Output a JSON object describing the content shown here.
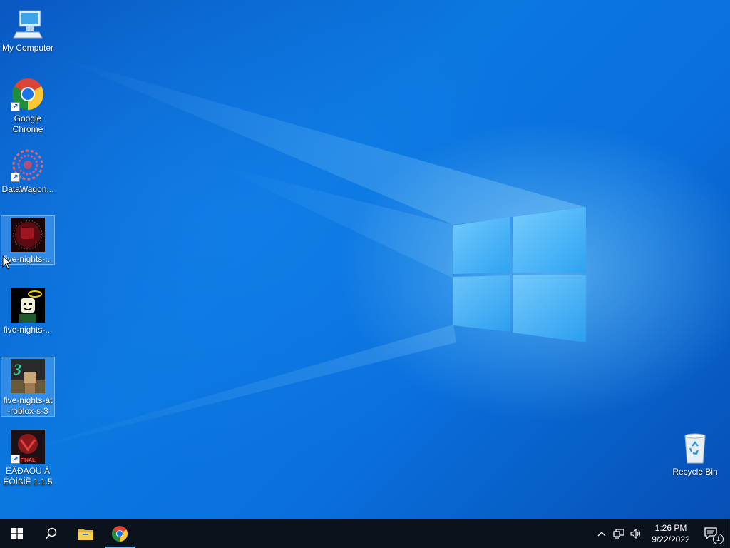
{
  "desktop": {
    "icons": [
      {
        "label": "My Computer",
        "icon": "computer-icon"
      },
      {
        "label": "Google\nChrome",
        "icon": "chrome-icon"
      },
      {
        "label": "DataWagon...",
        "icon": "datawagon-icon"
      },
      {
        "label": "five-nights-...",
        "icon": "game-dark-red-icon"
      },
      {
        "label": "five-nights-...",
        "icon": "game-roblox-face-icon"
      },
      {
        "label": "five-nights-at\n-roblox-s-3",
        "icon": "game-three-icon"
      },
      {
        "label": "ÈÃÐÀÒÜ Â\nÉÓÌßÍÊ 1.1.5",
        "icon": "game-final-icon"
      }
    ],
    "recycle_bin": {
      "label": "Recycle Bin",
      "icon": "recycle-bin-icon"
    }
  },
  "taskbar": {
    "start": "windows-start-icon",
    "search": "search-icon",
    "file_explorer": "folder-icon",
    "chrome": "chrome-icon",
    "clock_time": "1:26 PM",
    "clock_date": "9/22/2022",
    "notification_count": "1"
  },
  "colors": {
    "taskbar": "#0c121c",
    "accent": "#76b9ed",
    "desktop": "#0a6fdc"
  }
}
